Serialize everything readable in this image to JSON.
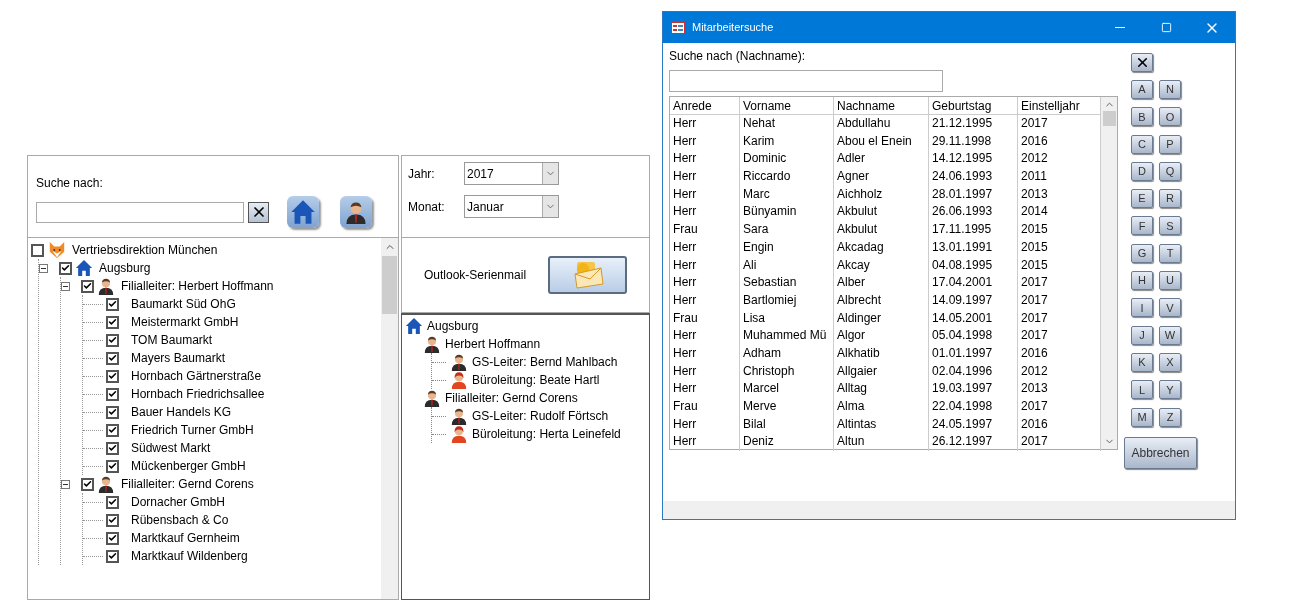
{
  "search_panel": {
    "label": "Suche nach:"
  },
  "tree": {
    "label": "Vertriebsdirektion München",
    "kind": "org",
    "checked": false,
    "children": [
      {
        "label": "Augsburg",
        "kind": "branch",
        "checked": true,
        "expanded": true,
        "children": [
          {
            "label": "Filialleiter: Herbert Hoffmann",
            "kind": "manager",
            "checked": true,
            "expanded": true,
            "children": [
              {
                "label": "Baumarkt Süd OhG",
                "kind": "store",
                "checked": true
              },
              {
                "label": "Meistermarkt GmbH",
                "kind": "store",
                "checked": true
              },
              {
                "label": "TOM Baumarkt",
                "kind": "store",
                "checked": true
              },
              {
                "label": "Mayers Baumarkt",
                "kind": "store",
                "checked": true
              },
              {
                "label": "Hornbach Gärtnerstraße",
                "kind": "store",
                "checked": true
              },
              {
                "label": "Hornbach Friedrichsallee",
                "kind": "store",
                "checked": true
              },
              {
                "label": "Bauer Handels KG",
                "kind": "store",
                "checked": true
              },
              {
                "label": "Friedrich Turner GmbH",
                "kind": "store",
                "checked": true
              },
              {
                "label": "Südwest Markt",
                "kind": "store",
                "checked": true
              },
              {
                "label": "Mückenberger GmbH",
                "kind": "store",
                "checked": true
              }
            ]
          },
          {
            "label": "Filialleiter: Gernd Corens",
            "kind": "manager",
            "checked": true,
            "expanded": true,
            "children": [
              {
                "label": "Dornacher GmbH",
                "kind": "store",
                "checked": true
              },
              {
                "label": "Rübensbach & Co",
                "kind": "store",
                "checked": true
              },
              {
                "label": "Marktkauf Gernheim",
                "kind": "store",
                "checked": true
              },
              {
                "label": "Marktkauf Wildenberg",
                "kind": "store",
                "checked": true
              }
            ]
          }
        ]
      }
    ]
  },
  "filters": [
    {
      "label": "Jahr:",
      "value": "2017"
    },
    {
      "label": "Monat:",
      "value": "Januar"
    }
  ],
  "mail": {
    "label": "Outlook-Serienmail"
  },
  "org_chart": {
    "label": "Augsburg",
    "kind": "branch",
    "children": [
      {
        "label": "Herbert Hoffmann",
        "kind": "man",
        "children": [
          {
            "label": "GS-Leiter: Bernd Mahlbach",
            "kind": "man"
          },
          {
            "label": "Büroleitung: Beate Hartl",
            "kind": "woman"
          }
        ]
      },
      {
        "label": "Filialleiter: Gernd Corens",
        "kind": "man",
        "children": [
          {
            "label": "GS-Leiter: Rudolf Förtsch",
            "kind": "man"
          },
          {
            "label": "Büroleitung: Herta Leinefeld",
            "kind": "woman"
          }
        ]
      }
    ]
  },
  "dialog": {
    "title": "Mitarbeitersuche",
    "search_label": "Suche nach (Nachname):",
    "columns": [
      "Anrede",
      "Vorname",
      "Nachname",
      "Geburtstag",
      "Einstelljahr"
    ],
    "rows": [
      [
        "Herr",
        "Nehat",
        "Abdullahu",
        "21.12.1995",
        "2017"
      ],
      [
        "Herr",
        "Karim",
        "Abou el Enein",
        "29.11.1998",
        "2016"
      ],
      [
        "Herr",
        "Dominic",
        "Adler",
        "14.12.1995",
        "2012"
      ],
      [
        "Herr",
        "Riccardo",
        "Agner",
        "24.06.1993",
        "2011"
      ],
      [
        "Herr",
        "Marc",
        "Aichholz",
        "28.01.1997",
        "2013"
      ],
      [
        "Herr",
        "Bünyamin",
        "Akbulut",
        "26.06.1993",
        "2014"
      ],
      [
        "Frau",
        "Sara",
        "Akbulut",
        "17.11.1995",
        "2015"
      ],
      [
        "Herr",
        "Engin",
        "Akcadag",
        "13.01.1991",
        "2015"
      ],
      [
        "Herr",
        "Ali",
        "Akcay",
        "04.08.1995",
        "2015"
      ],
      [
        "Herr",
        "Sebastian",
        "Alber",
        "17.04.2001",
        "2017"
      ],
      [
        "Herr",
        "Bartlomiej",
        "Albrecht",
        "14.09.1997",
        "2017"
      ],
      [
        "Frau",
        "Lisa",
        "Aldinger",
        "14.05.2001",
        "2017"
      ],
      [
        "Herr",
        "Muhammed Mü",
        "Algor",
        "05.04.1998",
        "2017"
      ],
      [
        "Herr",
        "Adham",
        "Alkhatib",
        "01.01.1997",
        "2016"
      ],
      [
        "Herr",
        "Christoph",
        "Allgaier",
        "02.04.1996",
        "2012"
      ],
      [
        "Herr",
        "Marcel",
        "Alltag",
        "19.03.1997",
        "2013"
      ],
      [
        "Frau",
        "Merve",
        "Alma",
        "22.04.1998",
        "2017"
      ],
      [
        "Herr",
        "Bilal",
        "Altintas",
        "24.05.1997",
        "2016"
      ],
      [
        "Herr",
        "Deniz",
        "Altun",
        "26.12.1997",
        "2017"
      ]
    ],
    "letters_left": [
      "A",
      "B",
      "C",
      "D",
      "E",
      "F",
      "G",
      "H",
      "I",
      "J",
      "K",
      "L",
      "M"
    ],
    "letters_right": [
      "N",
      "O",
      "P",
      "Q",
      "R",
      "S",
      "T",
      "U",
      "V",
      "W",
      "X",
      "Y",
      "Z"
    ],
    "cancel": "Abbrechen"
  }
}
